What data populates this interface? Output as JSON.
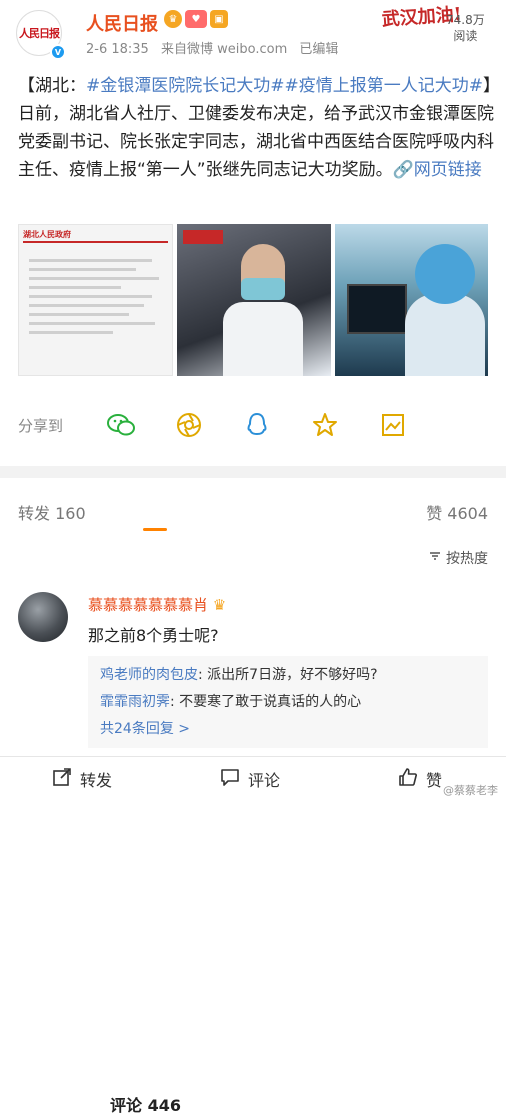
{
  "post": {
    "author_name": "人民日报",
    "avatar_logo": "人民日报",
    "meta_time": "2-6 18:35",
    "meta_source": "来自微博 weibo.com",
    "meta_edited": "已编辑",
    "stamp_text": "武汉加油!",
    "read_count": "74.8万",
    "read_label": "阅读",
    "text_prefix": "【湖北：",
    "tag1": "#金银潭医院院长记大功#",
    "tag2": "#疫情上报第一人记大功#",
    "text_suffix": "】日前，湖北省人社厅、卫健委发布决定，给予武汉市金银潭医院党委副书记、院长张定宇同志，湖北省中西医结合医院呼吸内科主任、疫情上报“第一人”张继先同志记大功奖励。",
    "link_label": "网页链接",
    "image1_header": "湖北人民政府"
  },
  "share": {
    "label": "分享到",
    "icons": [
      "wechat-icon",
      "moments-icon",
      "qq-icon",
      "favorite-icon",
      "save-image-icon"
    ]
  },
  "tabs": {
    "repost": "转发 160",
    "comment": "评论 446",
    "like": "赞 4604"
  },
  "sort": {
    "label": "按热度"
  },
  "comment": {
    "name": "慕慕慕慕慕慕慕肖",
    "text": "那之前8个勇士呢?",
    "replies": [
      {
        "who": "鸡老师的肉包皮",
        "text": ": 派出所7日游，好不够好吗?"
      },
      {
        "who": "霏霏雨初霁",
        "text": ": 不要寒了敢于说真话的人的心"
      }
    ],
    "more": "共24条回复 >"
  },
  "bottom_bar": {
    "repost": "转发",
    "comment": "评论",
    "like": "赞"
  },
  "watermark": "@蔡蔡老李",
  "colors": {
    "accent": "#e8501f",
    "link": "#4a7bc1",
    "tab_underline": "#ff8200"
  }
}
